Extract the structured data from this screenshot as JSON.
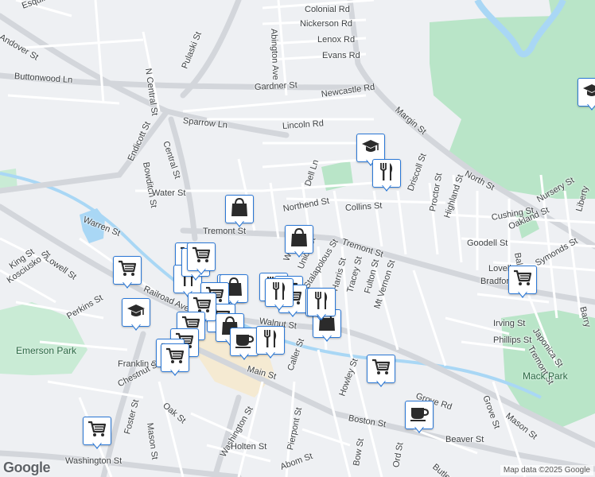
{
  "map": {
    "attribution": "Map data ©2025 Google",
    "logo": "Google",
    "street_labels": [
      "Andover St",
      "Esquire Dr",
      "Colonial Rd",
      "Nickerson Rd",
      "Lenox Rd",
      "Evans Rd",
      "Pulaski St",
      "N Central St",
      "Abington Ave",
      "Buttonwood Ln",
      "Gardner St",
      "Newcastle Rd",
      "Margin St",
      "Endicott St",
      "Central St",
      "Sparrow Ln",
      "Lincoln Rd",
      "Bowditch St",
      "Water St",
      "Dell Ln",
      "Driscoll St",
      "Proctor St",
      "Highland St",
      "Nursery St",
      "North St",
      "Northend St",
      "Collins St",
      "Cushing St",
      "Oakland St",
      "Warren St",
      "Tremont St",
      "Goodell St",
      "Liberty",
      "Lowell St",
      "King St",
      "Kosciusko St",
      "Webb",
      "Union St",
      "Stalapolous St",
      "Harris St",
      "Tracey St",
      "Fulton St",
      "Tremont St",
      "Symonds St",
      "Railroad Ave",
      "Perkins St",
      "Walnut St",
      "Mt Vernon St",
      "Lovell",
      "Bradford",
      "Irving St",
      "Phillips St",
      "Japonica St",
      "Tremont St",
      "Franklin St",
      "Chestnut St",
      "Caller St",
      "Howley St",
      "Main St",
      "Grove St",
      "Foster St",
      "Oak St",
      "Mason St",
      "Washington St",
      "Boston St",
      "Beaver St",
      "Mason St",
      "Pierpont St",
      "Holten St",
      "Abom St",
      "Bow St",
      "Ord St",
      "Butler",
      "Washington St",
      "Barry",
      "Grove Rd",
      "Balcomb"
    ],
    "park_labels": [
      "Emerson Park",
      "Mack Park"
    ],
    "markers": [
      "school",
      "restaurant",
      "shopping",
      "shopping",
      "grocery",
      "grocery",
      "restaurant",
      "shopping",
      "grocery",
      "grocery",
      "restaurant",
      "grocery",
      "shopping",
      "grocery",
      "school",
      "grocery",
      "grocery",
      "grocery",
      "grocery",
      "grocery",
      "shopping",
      "cafe",
      "restaurant",
      "shopping",
      "grocery",
      "cafe",
      "grocery",
      "grocery",
      "school",
      "grocery",
      "grocery",
      "restaurant",
      "restaurant",
      "grocery"
    ]
  },
  "colors": {
    "background": "#eef0f3",
    "park": "#b9e5c8",
    "road": "#ffffff",
    "arterial": "#dadde2",
    "water": "#a9d7f5",
    "marker_border": "#2b78d6",
    "marker_icon": "#2b2b2b"
  }
}
